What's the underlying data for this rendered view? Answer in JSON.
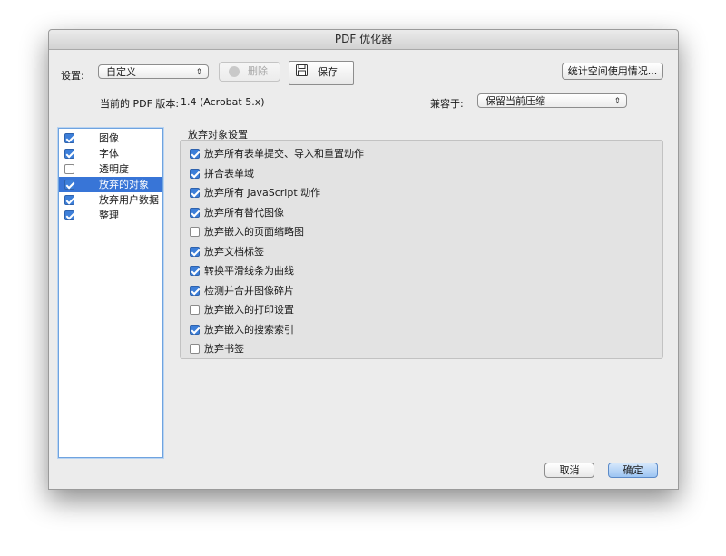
{
  "window": {
    "title": "PDF 优化器"
  },
  "toolbar": {
    "settings_label": "设置:",
    "settings_value": "自定义",
    "delete_label": "删除",
    "save_label": "保存",
    "audit_label": "统计空间使用情况..."
  },
  "version": {
    "label": "当前的 PDF 版本:",
    "value": "1.4 (Acrobat 5.x)",
    "compat_label": "兼容于:",
    "compat_value": "保留当前压缩"
  },
  "sidebar": {
    "items": [
      {
        "label": "图像",
        "checked": true,
        "selected": false
      },
      {
        "label": "字体",
        "checked": true,
        "selected": false
      },
      {
        "label": "透明度",
        "checked": false,
        "selected": false
      },
      {
        "label": "放弃的对象",
        "checked": true,
        "selected": true
      },
      {
        "label": "放弃用户数据",
        "checked": true,
        "selected": false
      },
      {
        "label": "整理",
        "checked": true,
        "selected": false
      }
    ]
  },
  "panel": {
    "title": "放弃对象设置",
    "options": [
      {
        "label": "放弃所有表单提交、导入和重置动作",
        "checked": true
      },
      {
        "label": "拼合表单域",
        "checked": true
      },
      {
        "label": "放弃所有 JavaScript 动作",
        "checked": true
      },
      {
        "label": "放弃所有替代图像",
        "checked": true
      },
      {
        "label": "放弃嵌入的页面缩略图",
        "checked": false
      },
      {
        "label": "放弃文档标签",
        "checked": true
      },
      {
        "label": "转换平滑线条为曲线",
        "checked": true
      },
      {
        "label": "检测并合并图像碎片",
        "checked": true
      },
      {
        "label": "放弃嵌入的打印设置",
        "checked": false
      },
      {
        "label": "放弃嵌入的搜索索引",
        "checked": true
      },
      {
        "label": "放弃书签",
        "checked": false
      }
    ]
  },
  "footer": {
    "cancel_label": "取消",
    "ok_label": "确定"
  }
}
